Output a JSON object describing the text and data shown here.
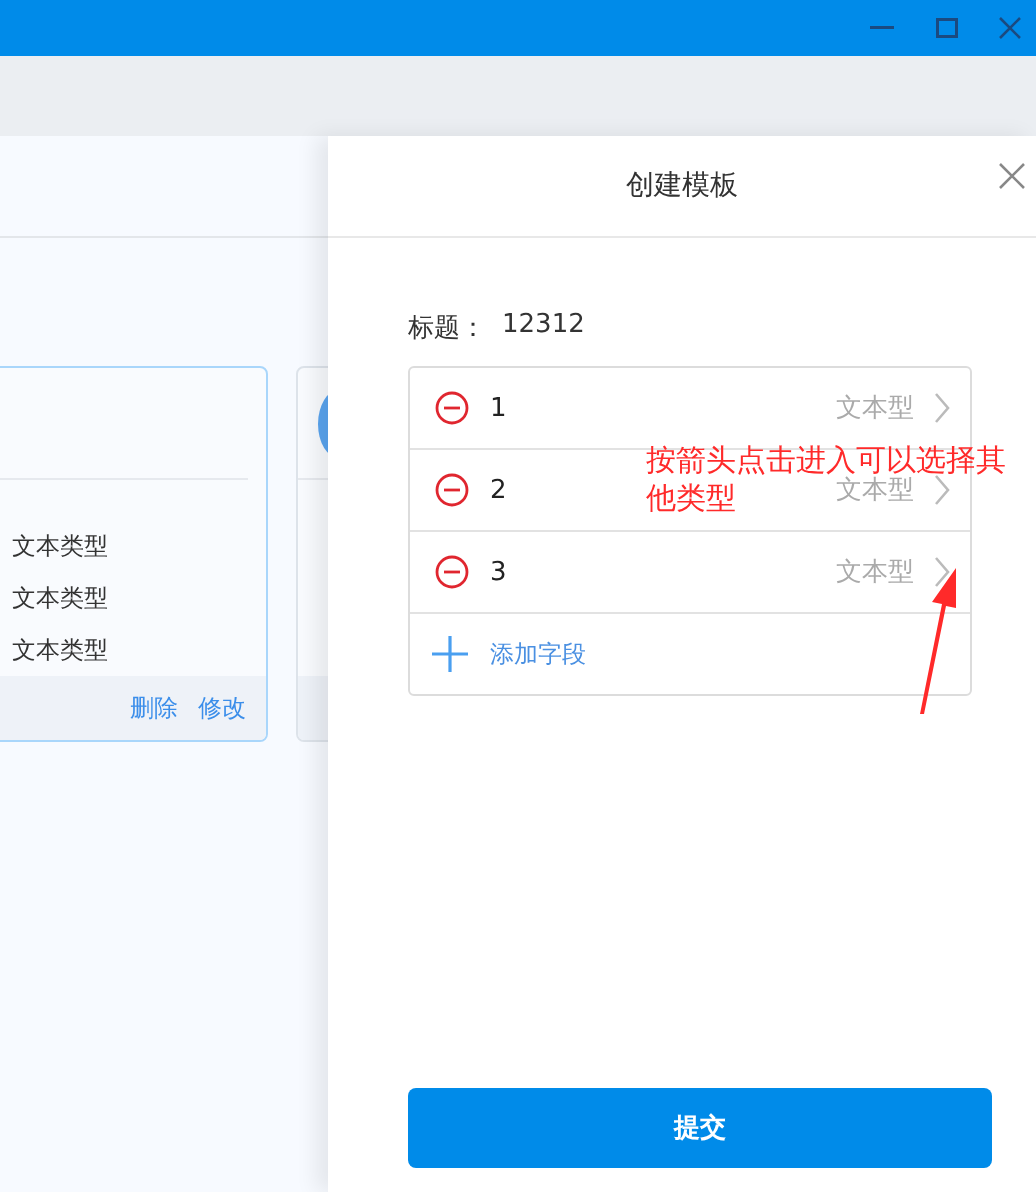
{
  "cards": [
    {
      "kind": "list",
      "lines": [
        "文本类型",
        "文本类型",
        "文本类型"
      ],
      "actions": [
        "删除",
        "修改"
      ]
    },
    {
      "kind": "avatar"
    }
  ],
  "drawer": {
    "title": "创建模板",
    "label": "标题：",
    "value": "12312",
    "fields": [
      {
        "name": "1",
        "type": "文本型"
      },
      {
        "name": "2",
        "type": "文本型"
      },
      {
        "name": "3",
        "type": "文本型"
      }
    ],
    "add_label": "添加字段",
    "submit": "提交"
  },
  "annotation": {
    "lines": [
      "按箭头点击进入可以选择其",
      "他类型"
    ]
  }
}
